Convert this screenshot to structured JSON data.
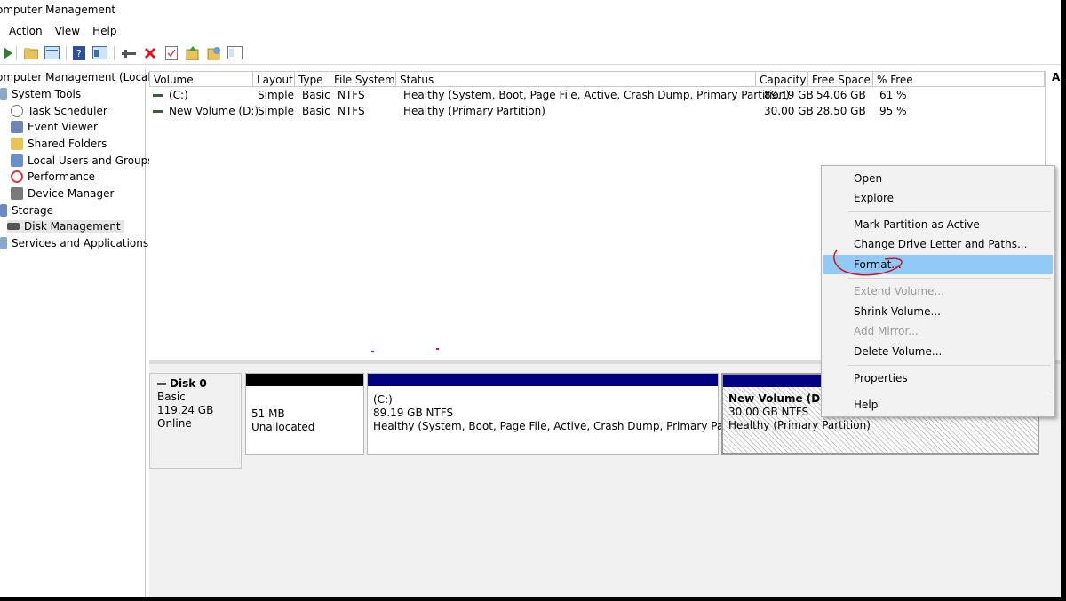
{
  "window": {
    "title": "omputer Management"
  },
  "menubar": [
    "Action",
    "View",
    "Help"
  ],
  "toolbar": {
    "icons": [
      "play-icon",
      "folder-icon",
      "console-icon",
      "help-book-icon",
      "properties-icon",
      "connect-icon",
      "delete-icon",
      "checklist-icon",
      "export-icon",
      "rescan-icon",
      "disk-view-icon"
    ],
    "delete_color": "#e81123"
  },
  "tree": {
    "root": "omputer Management (Local",
    "items": [
      {
        "label": "System Tools",
        "icon": "tools-icon"
      },
      {
        "label": "Task Scheduler",
        "icon": "clock-icon"
      },
      {
        "label": "Event Viewer",
        "icon": "event-viewer-icon"
      },
      {
        "label": "Shared Folders",
        "icon": "shared-folder-icon"
      },
      {
        "label": "Local Users and Groups",
        "icon": "users-icon"
      },
      {
        "label": "Performance",
        "icon": "performance-icon"
      },
      {
        "label": "Device Manager",
        "icon": "device-manager-icon"
      },
      {
        "label": "Storage",
        "icon": "storage-icon"
      },
      {
        "label": "Disk Management",
        "icon": "disk-icon"
      },
      {
        "label": "Services and Applications",
        "icon": "services-icon"
      }
    ]
  },
  "volume_list": {
    "columns": [
      "Volume",
      "Layout",
      "Type",
      "File System",
      "Status",
      "Capacity",
      "Free Space",
      "% Free"
    ],
    "rows": [
      {
        "volume": "(C:)",
        "layout": "Simple",
        "type": "Basic",
        "fs": "NTFS",
        "status": "Healthy (System, Boot, Page File, Active, Crash Dump, Primary Partition)",
        "capacity": "89.19 GB",
        "free": "54.06 GB",
        "pct": "61 %"
      },
      {
        "volume": "New Volume (D:)",
        "layout": "Simple",
        "type": "Basic",
        "fs": "NTFS",
        "status": "Healthy (Primary Partition)",
        "capacity": "30.00 GB",
        "free": "28.50 GB",
        "pct": "95 %"
      }
    ]
  },
  "disk": {
    "name": "Disk 0",
    "type": "Basic",
    "size": "119.24 GB",
    "state": "Online",
    "partitions": [
      {
        "line1": "51 MB",
        "line2": "Unallocated",
        "line3": "",
        "bar_color": "#000000"
      },
      {
        "line1": "(C:)",
        "line2": "89.19 GB NTFS",
        "line3": "Healthy (System, Boot, Page File, Active, Crash Dump, Primary Partitio",
        "bar_color": "#000080"
      },
      {
        "line1": "New Volume  (D:)",
        "line2": "30.00 GB NTFS",
        "line3": "Healthy (Primary Partition)",
        "bar_color": "#000080"
      }
    ]
  },
  "action_pane": {
    "header": "A"
  },
  "context_menu": {
    "items": [
      {
        "label": "Open",
        "enabled": true
      },
      {
        "label": "Explore",
        "enabled": true
      },
      {
        "label": "Mark Partition as Active",
        "enabled": true
      },
      {
        "label": "Change Drive Letter and Paths...",
        "enabled": true
      },
      {
        "label": "Format...",
        "enabled": true,
        "highlighted": true
      },
      {
        "label": "Extend Volume...",
        "enabled": false
      },
      {
        "label": "Shrink Volume...",
        "enabled": true
      },
      {
        "label": "Add Mirror...",
        "enabled": false
      },
      {
        "label": "Delete Volume...",
        "enabled": true
      },
      {
        "label": "Properties",
        "enabled": true
      },
      {
        "label": "Help",
        "enabled": true
      }
    ],
    "highlight_color": "#91c9f7",
    "annotation_color": "#d8141a"
  }
}
